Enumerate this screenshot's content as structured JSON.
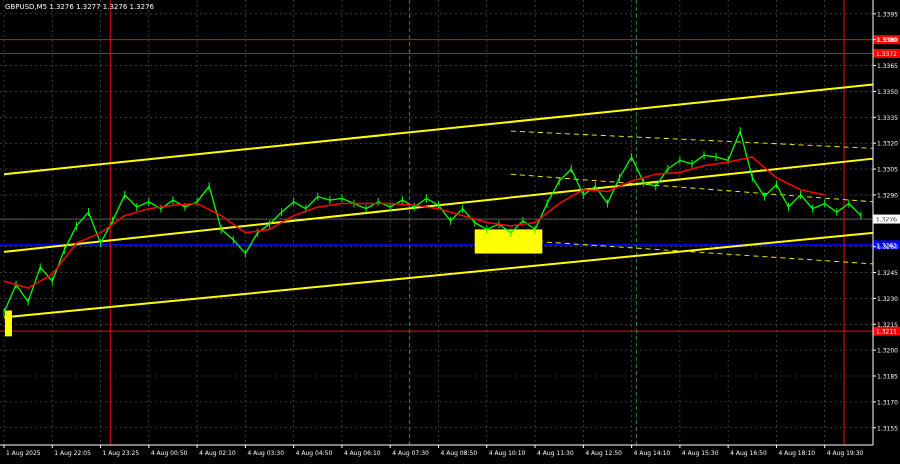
{
  "chart_data": {
    "type": "line",
    "title": "GBPUSD,M5  1.3276 1.3277 1.3276 1.3276",
    "symbol": "GBPUSD,M5",
    "ohlc": "1.3276 1.3277 1.3276 1.3276",
    "colors": {
      "background": "#000000",
      "price": "#00ff00",
      "ma": "#ff0000",
      "channel": "#ffff00",
      "level_red": "#ff0000",
      "level_blue": "#0000ff",
      "axis": "#ffffff",
      "grid": "#606060"
    },
    "ylim": [
      1.3145,
      1.3403
    ],
    "y_ticks": [
      "1.3395",
      "1.3380",
      "1.3365",
      "1.3350",
      "1.3335",
      "1.3320",
      "1.3305",
      "1.3290",
      "1.3276",
      "1.3260",
      "1.3245",
      "1.3230",
      "1.3215",
      "1.3200",
      "1.3185",
      "1.3170",
      "1.3155"
    ],
    "x_ticks": [
      "1 Aug 2025",
      "1 Aug 22:05",
      "1 Aug 23:25",
      "4 Aug 00:50",
      "4 Aug 02:10",
      "4 Aug 03:30",
      "4 Aug 04:50",
      "4 Aug 06:10",
      "4 Aug 07:30",
      "4 Aug 08:50",
      "4 Aug 10:10",
      "4 Aug 11:30",
      "4 Aug 12:50",
      "4 Aug 14:10",
      "4 Aug 15:30",
      "4 Aug 16:50",
      "4 Aug 18:10",
      "4 Aug 19:30"
    ],
    "x_count": 18,
    "horizontal_levels": [
      {
        "value": 1.338,
        "color": "red",
        "label": "1.3380"
      },
      {
        "value": 1.3372,
        "color": "red",
        "label": "1.3372"
      },
      {
        "value": 1.3261,
        "color": "blue",
        "label": "1.3261"
      },
      {
        "value": 1.3211,
        "color": "red",
        "label": "1.3211"
      }
    ],
    "current_price": {
      "value": 1.3276,
      "label": "1.3276"
    },
    "vertical_lines": [
      {
        "x": 2.2,
        "style": "red-solid"
      },
      {
        "x": 8.4,
        "style": "green-dashed"
      },
      {
        "x": 13.1,
        "style": "green-dashed"
      },
      {
        "x": 17.4,
        "style": "red-solid"
      }
    ],
    "trendlines": [
      {
        "name": "channel-upper",
        "from": [
          0,
          1.3302
        ],
        "to": [
          18,
          1.3354
        ],
        "style": "solid"
      },
      {
        "name": "channel-middle",
        "from": [
          0,
          1.3257
        ],
        "to": [
          18,
          1.3311
        ],
        "style": "solid"
      },
      {
        "name": "channel-lower",
        "from": [
          0,
          1.3219
        ],
        "to": [
          18,
          1.3268
        ],
        "style": "solid"
      },
      {
        "name": "dashed-top",
        "from": [
          10.5,
          1.3327
        ],
        "to": [
          18,
          1.3317
        ],
        "style": "dashed"
      },
      {
        "name": "dashed-middle",
        "from": [
          10.5,
          1.3302
        ],
        "to": [
          18,
          1.3286
        ],
        "style": "dashed"
      },
      {
        "name": "dashed-bottom",
        "from": [
          10.5,
          1.3264
        ],
        "to": [
          18,
          1.325
        ],
        "style": "dashed"
      }
    ],
    "markers": [
      {
        "x": 0.02,
        "y1": 1.3208,
        "y2": 1.3223
      },
      {
        "x": 9.75,
        "x2": 11.15,
        "y1": 1.3256,
        "y2": 1.327
      }
    ],
    "series": [
      {
        "name": "",
        "role": "price",
        "x": [
          0.0,
          0.25,
          0.5,
          0.75,
          1.0,
          1.25,
          1.5,
          1.75,
          2.0,
          2.25,
          2.5,
          2.75,
          3.0,
          3.25,
          3.5,
          3.75,
          4.0,
          4.25,
          4.5,
          4.75,
          5.0,
          5.25,
          5.5,
          5.75,
          6.0,
          6.25,
          6.5,
          6.75,
          7.0,
          7.25,
          7.5,
          7.75,
          8.0,
          8.25,
          8.5,
          8.75,
          9.0,
          9.25,
          9.5,
          9.75,
          10.0,
          10.25,
          10.5,
          10.75,
          11.0,
          11.25,
          11.5,
          11.75,
          12.0,
          12.25,
          12.5,
          12.75,
          13.0,
          13.25,
          13.5,
          13.75,
          14.0,
          14.25,
          14.5,
          14.75,
          15.0,
          15.25,
          15.5,
          15.75,
          16.0,
          16.25,
          16.5,
          16.75,
          17.0,
          17.25,
          17.5,
          17.75
        ],
        "y": [
          1.3222,
          1.3238,
          1.3228,
          1.3248,
          1.324,
          1.3258,
          1.3272,
          1.328,
          1.3262,
          1.3275,
          1.329,
          1.3283,
          1.3286,
          1.3282,
          1.3287,
          1.3283,
          1.3286,
          1.3295,
          1.327,
          1.3264,
          1.3256,
          1.3268,
          1.3273,
          1.328,
          1.3286,
          1.3282,
          1.3289,
          1.3287,
          1.3288,
          1.3285,
          1.3282,
          1.3286,
          1.3283,
          1.3287,
          1.3283,
          1.3288,
          1.3284,
          1.3275,
          1.3282,
          1.3274,
          1.327,
          1.3273,
          1.3268,
          1.3275,
          1.327,
          1.3285,
          1.3298,
          1.3305,
          1.329,
          1.3295,
          1.3285,
          1.33,
          1.3312,
          1.3297,
          1.3295,
          1.3305,
          1.331,
          1.3308,
          1.3313,
          1.3312,
          1.331,
          1.3327,
          1.33,
          1.3289,
          1.3296,
          1.3283,
          1.329,
          1.3282,
          1.3285,
          1.328,
          1.3285,
          1.3278
        ]
      },
      {
        "name": "",
        "role": "moving-average",
        "x": [
          0.0,
          0.5,
          1.0,
          1.5,
          2.0,
          2.5,
          3.0,
          3.5,
          4.0,
          4.5,
          5.0,
          5.5,
          6.0,
          6.5,
          7.0,
          7.5,
          8.0,
          8.5,
          9.0,
          9.5,
          10.0,
          10.5,
          11.0,
          11.5,
          12.0,
          12.5,
          13.0,
          13.5,
          14.0,
          14.5,
          15.0,
          15.5,
          16.0,
          16.5,
          17.0
        ],
        "y": [
          1.324,
          1.3236,
          1.3244,
          1.3262,
          1.3268,
          1.3278,
          1.3282,
          1.3284,
          1.3285,
          1.3278,
          1.3268,
          1.327,
          1.3278,
          1.3283,
          1.3285,
          1.3285,
          1.3285,
          1.3284,
          1.3282,
          1.3278,
          1.3274,
          1.3272,
          1.3274,
          1.3285,
          1.3293,
          1.3292,
          1.3298,
          1.3302,
          1.3303,
          1.3307,
          1.3309,
          1.3312,
          1.33,
          1.3293,
          1.329
        ]
      }
    ],
    "xlabel": "",
    "ylabel": "",
    "grid": true
  }
}
